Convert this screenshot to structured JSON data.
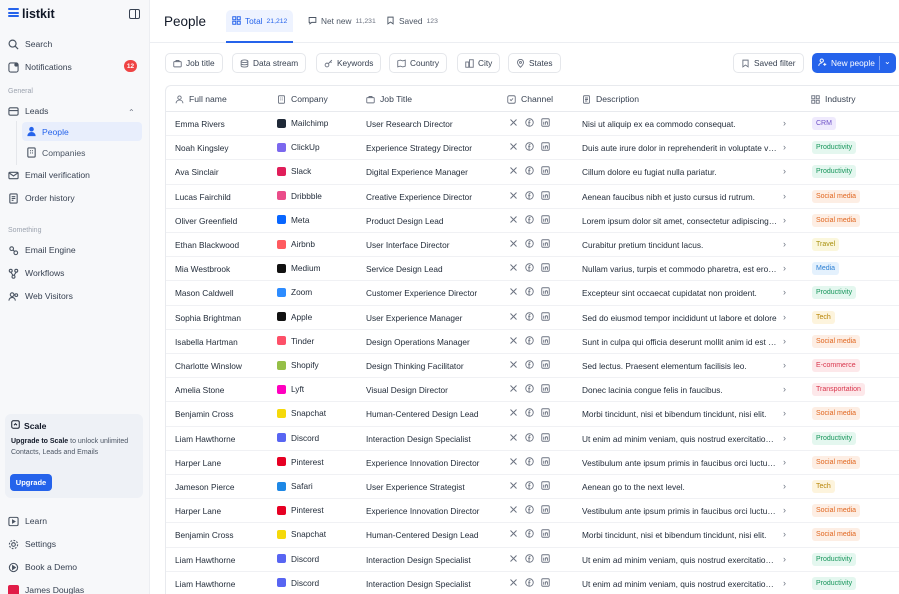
{
  "app": {
    "name": "listkit"
  },
  "sidebar": {
    "search": "Search",
    "notifications": "Notifications",
    "notifications_count": "12",
    "general_label": "General",
    "leads": "Leads",
    "people": "People",
    "companies": "Companies",
    "email_verification": "Email verification",
    "order_history": "Order history",
    "something_label": "Something",
    "email_engine": "Email Engine",
    "workflows": "Workflows",
    "web_visitors": "Web Visitors",
    "upgrade": {
      "title": "Scale",
      "highlight": "Upgrade to Scale",
      "text": " to unlock unlimited Contacts, Leads and Emails",
      "button": "Upgrade"
    },
    "learn": "Learn",
    "settings": "Settings",
    "book_demo": "Book a Demo",
    "user_name": "James Douglas"
  },
  "header": {
    "title": "People",
    "tabs": [
      {
        "label": "Total",
        "count": "21,212"
      },
      {
        "label": "Net new",
        "count": "11,231"
      },
      {
        "label": "Saved",
        "count": "123"
      }
    ]
  },
  "filters": {
    "job_title": "Job title",
    "data_stream": "Data stream",
    "keywords": "Keywords",
    "country": "Country",
    "city": "City",
    "states": "States",
    "saved_filter": "Saved filter",
    "new_people": "New people"
  },
  "table": {
    "headers": {
      "name": "Full name",
      "company": "Company",
      "title": "Job Title",
      "channel": "Channel",
      "description": "Description",
      "industry": "Industry"
    },
    "rows": [
      {
        "name": "Emma Rivers",
        "company": "Mailchimp",
        "logo_color": "#1f2937",
        "title": "User Research Director",
        "desc": "Nisi ut aliquip ex ea commodo consequat.",
        "industry": "CRM",
        "tag_bg": "#efeafd",
        "tag_fg": "#6d4fc7"
      },
      {
        "name": "Noah Kingsley",
        "company": "ClickUp",
        "logo_color": "#7b68ee",
        "title": "Experience Strategy Director",
        "desc": "Duis aute irure dolor in reprehenderit in voluptate velit",
        "industry": "Productivity",
        "tag_bg": "#e4f7ef",
        "tag_fg": "#16955a"
      },
      {
        "name": "Ava Sinclair",
        "company": "Slack",
        "logo_color": "#e01e5a",
        "title": "Digital Experience Manager",
        "desc": "Cillum dolore eu fugiat nulla pariatur.",
        "industry": "Productivity",
        "tag_bg": "#e4f7ef",
        "tag_fg": "#16955a"
      },
      {
        "name": "Lucas Fairchild",
        "company": "Dribbble",
        "logo_color": "#ea4c89",
        "title": "Creative Experience Director",
        "desc": "Aenean faucibus nibh et justo cursus id rutrum.",
        "industry": "Social media",
        "tag_bg": "#fdeee4",
        "tag_fg": "#e0661f"
      },
      {
        "name": "Oliver Greenfield",
        "company": "Meta",
        "logo_color": "#0866ff",
        "title": "Product Design Lead",
        "desc": "Lorem ipsum dolor sit amet, consectetur adipiscing elit.",
        "industry": "Social media",
        "tag_bg": "#fdeee4",
        "tag_fg": "#e0661f"
      },
      {
        "name": "Ethan Blackwood",
        "company": "Airbnb",
        "logo_color": "#ff5a5f",
        "title": "User Interface Director",
        "desc": "Curabitur pretium tincidunt lacus.",
        "industry": "Travel",
        "tag_bg": "#fbf7dc",
        "tag_fg": "#a8900c"
      },
      {
        "name": "Mia Westbrook",
        "company": "Medium",
        "logo_color": "#111111",
        "title": "Service Design Lead",
        "desc": "Nullam varius, turpis et commodo pharetra, est eros bibendum",
        "industry": "Media",
        "tag_bg": "#e4f1fd",
        "tag_fg": "#2c7fd3"
      },
      {
        "name": "Mason Caldwell",
        "company": "Zoom",
        "logo_color": "#2d8cff",
        "title": "Customer Experience Director",
        "desc": "Excepteur sint occaecat cupidatat non proident.",
        "industry": "Productivity",
        "tag_bg": "#e4f7ef",
        "tag_fg": "#16955a"
      },
      {
        "name": "Sophia Brightman",
        "company": "Apple",
        "logo_color": "#111111",
        "title": "User Experience Manager",
        "desc": "Sed do eiusmod tempor incididunt ut labore et dolore",
        "industry": "Tech",
        "tag_bg": "#fdf4dd",
        "tag_fg": "#b88508"
      },
      {
        "name": "Isabella Hartman",
        "company": "Tinder",
        "logo_color": "#fd5068",
        "title": "Design Operations Manager",
        "desc": "Sunt in culpa qui officia deserunt mollit anim id est laborum.",
        "industry": "Social media",
        "tag_bg": "#fdeee4",
        "tag_fg": "#e0661f"
      },
      {
        "name": "Charlotte Winslow",
        "company": "Shopify",
        "logo_color": "#95bf47",
        "title": "Design Thinking Facilitator",
        "desc": "Sed lectus. Praesent elementum facilisis leo.",
        "industry": "E-commerce",
        "tag_bg": "#fde8ea",
        "tag_fg": "#d8344b"
      },
      {
        "name": "Amelia Stone",
        "company": "Lyft",
        "logo_color": "#ff00bf",
        "title": "Visual Design Director",
        "desc": "Donec lacinia congue felis in faucibus.",
        "industry": "Transportation",
        "tag_bg": "#fde8ea",
        "tag_fg": "#d8344b"
      },
      {
        "name": "Benjamin Cross",
        "company": "Snapchat",
        "logo_color": "#f5d90a",
        "title": "Human-Centered Design Lead",
        "desc": "Morbi tincidunt, nisi et bibendum tincidunt, nisi elit.",
        "industry": "Social media",
        "tag_bg": "#fdeee4",
        "tag_fg": "#e0661f"
      },
      {
        "name": "Liam Hawthorne",
        "company": "Discord",
        "logo_color": "#5865f2",
        "title": "Interaction Design Specialist",
        "desc": "Ut enim ad minim veniam, quis nostrud exercitation ullamco",
        "industry": "Productivity",
        "tag_bg": "#e4f7ef",
        "tag_fg": "#16955a"
      },
      {
        "name": "Harper Lane",
        "company": "Pinterest",
        "logo_color": "#e60023",
        "title": "Experience Innovation Director",
        "desc": "Vestibulum ante ipsum primis in faucibus orci luctus et",
        "industry": "Social media",
        "tag_bg": "#fdeee4",
        "tag_fg": "#e0661f"
      },
      {
        "name": "Jameson Pierce",
        "company": "Safari",
        "logo_color": "#1e88e5",
        "title": "User Experience Strategist",
        "desc": "Aenean go to the next level.",
        "industry": "Tech",
        "tag_bg": "#fdf4dd",
        "tag_fg": "#b88508"
      },
      {
        "name": "Harper Lane",
        "company": "Pinterest",
        "logo_color": "#e60023",
        "title": "Experience Innovation Director",
        "desc": "Vestibulum ante ipsum primis in faucibus orci luctus et",
        "industry": "Social media",
        "tag_bg": "#fdeee4",
        "tag_fg": "#e0661f"
      },
      {
        "name": "Benjamin Cross",
        "company": "Snapchat",
        "logo_color": "#f5d90a",
        "title": "Human-Centered Design Lead",
        "desc": "Morbi tincidunt, nisi et bibendum tincidunt, nisi elit.",
        "industry": "Social media",
        "tag_bg": "#fdeee4",
        "tag_fg": "#e0661f"
      },
      {
        "name": "Liam Hawthorne",
        "company": "Discord",
        "logo_color": "#5865f2",
        "title": "Interaction Design Specialist",
        "desc": "Ut enim ad minim veniam, quis nostrud exercitation ullamco",
        "industry": "Productivity",
        "tag_bg": "#e4f7ef",
        "tag_fg": "#16955a"
      },
      {
        "name": "Liam Hawthorne",
        "company": "Discord",
        "logo_color": "#5865f2",
        "title": "Interaction Design Specialist",
        "desc": "Ut enim ad minim veniam, quis nostrud exercitation ullamco",
        "industry": "Productivity",
        "tag_bg": "#e4f7ef",
        "tag_fg": "#16955a"
      }
    ]
  },
  "colors": {
    "accent": "#2563eb",
    "badge": "#ef4444"
  },
  "icons": {
    "channels": [
      "x-icon",
      "facebook-icon",
      "linkedin-icon"
    ],
    "row_action": "chevron-right-icon"
  }
}
